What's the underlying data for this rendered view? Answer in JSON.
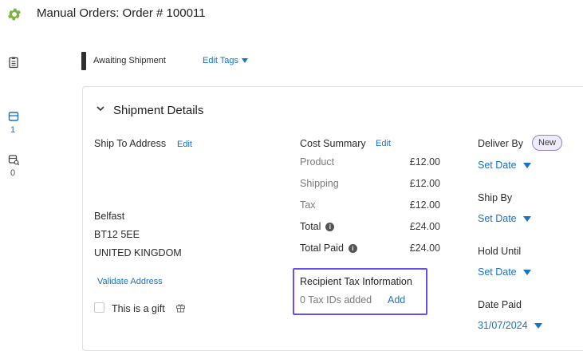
{
  "header": {
    "title": "Manual Orders:  Order # 100011",
    "gear_color": "#7cb342"
  },
  "sidebar": {
    "counts": [
      "1",
      "0"
    ]
  },
  "status": {
    "label": "Awaiting Shipment",
    "edit_tags": "Edit Tags"
  },
  "shipment": {
    "title": "Shipment Details",
    "ship_to": {
      "label": "Ship To Address",
      "edit": "Edit",
      "city": "Belfast",
      "postcode": "BT12 5EE",
      "country": "UNITED KINGDOM",
      "validate": "Validate Address",
      "gift": "This is a gift"
    },
    "cost": {
      "label": "Cost Summary",
      "edit": "Edit",
      "rows": [
        {
          "label": "Product",
          "value": "£12.00"
        },
        {
          "label": "Shipping",
          "value": "£12.00"
        },
        {
          "label": "Tax",
          "value": "£12.00"
        },
        {
          "label": "Total",
          "value": "£24.00"
        },
        {
          "label": "Total Paid",
          "value": "£24.00"
        }
      ]
    },
    "tax_info": {
      "title": "Recipient Tax Information",
      "summary": "0 Tax IDs added",
      "add": "Add"
    },
    "dates": {
      "deliver_by": {
        "label": "Deliver By",
        "badge": "New",
        "value": "Set Date"
      },
      "ship_by": {
        "label": "Ship By",
        "value": "Set Date"
      },
      "hold_until": {
        "label": "Hold Until",
        "value": "Set Date"
      },
      "date_paid": {
        "label": "Date Paid",
        "value": "31/07/2024"
      }
    }
  }
}
